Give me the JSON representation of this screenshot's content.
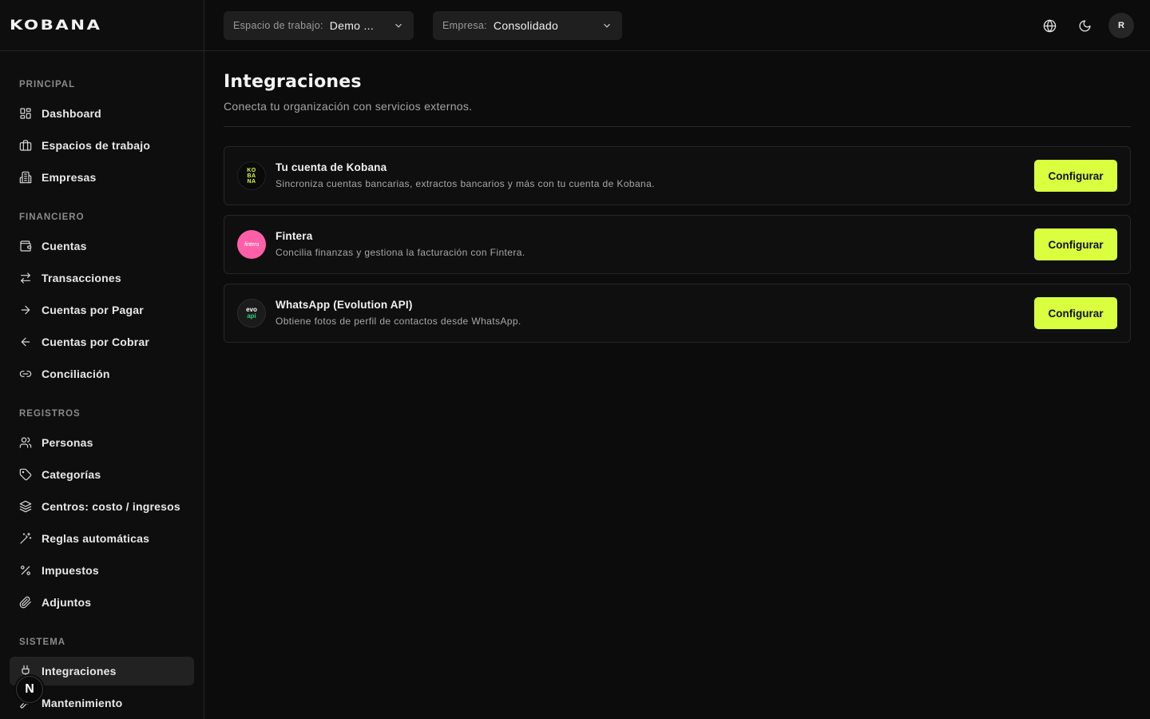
{
  "brand": {
    "logo_text": "KOBANA",
    "accent": "#d9ff3f"
  },
  "topbar": {
    "workspace": {
      "label": "Espacio de trabajo:",
      "value": "Demo ..."
    },
    "company": {
      "label": "Empresa:",
      "value": "Consolidado"
    },
    "icons": [
      "globe-icon",
      "moon-icon"
    ],
    "avatar": "R"
  },
  "sidebar": {
    "sections": [
      {
        "label": "PRINCIPAL",
        "items": [
          {
            "label": "Dashboard",
            "icon": "dashboard-icon"
          },
          {
            "label": "Espacios de trabajo",
            "icon": "briefcase-icon"
          },
          {
            "label": "Empresas",
            "icon": "building-icon"
          }
        ]
      },
      {
        "label": "FINANCIERO",
        "items": [
          {
            "label": "Cuentas",
            "icon": "wallet-icon"
          },
          {
            "label": "Transacciones",
            "icon": "arrows-exchange-icon"
          },
          {
            "label": "Cuentas por Pagar",
            "icon": "arrow-right-icon"
          },
          {
            "label": "Cuentas por Cobrar",
            "icon": "arrow-left-icon"
          },
          {
            "label": "Conciliación",
            "icon": "link-icon"
          }
        ]
      },
      {
        "label": "REGISTROS",
        "items": [
          {
            "label": "Personas",
            "icon": "users-icon"
          },
          {
            "label": "Categorías",
            "icon": "tag-icon"
          },
          {
            "label": "Centros: costo / ingresos",
            "icon": "layers-icon"
          },
          {
            "label": "Reglas automáticas",
            "icon": "wand-icon"
          },
          {
            "label": "Impuestos",
            "icon": "percent-icon"
          },
          {
            "label": "Adjuntos",
            "icon": "paperclip-icon"
          }
        ]
      },
      {
        "label": "SISTEMA",
        "items": [
          {
            "label": "Integraciones",
            "icon": "plug-icon",
            "active": true
          },
          {
            "label": "Mantenimiento",
            "icon": "wrench-icon"
          }
        ]
      }
    ],
    "floating_badge": "N"
  },
  "page": {
    "title": "Integraciones",
    "subtitle": "Conecta tu organización con servicios externos."
  },
  "integrations": [
    {
      "name": "Tu cuenta de Kobana",
      "description": "Sincroniza cuentas bancarias, extractos bancarios y más con tu cuenta de Kobana.",
      "logo_lines": [
        "KO",
        "BA",
        "NA"
      ],
      "button": "Configurar"
    },
    {
      "name": "Fintera",
      "description": "Concilia finanzas y gestiona la facturación con Fintera.",
      "logo_text": "fintera",
      "button": "Configurar"
    },
    {
      "name": "WhatsApp (Evolution API)",
      "description": "Obtiene fotos de perfil de contactos desde WhatsApp.",
      "logo_lines": [
        "evo",
        "api"
      ],
      "button": "Configurar"
    }
  ]
}
